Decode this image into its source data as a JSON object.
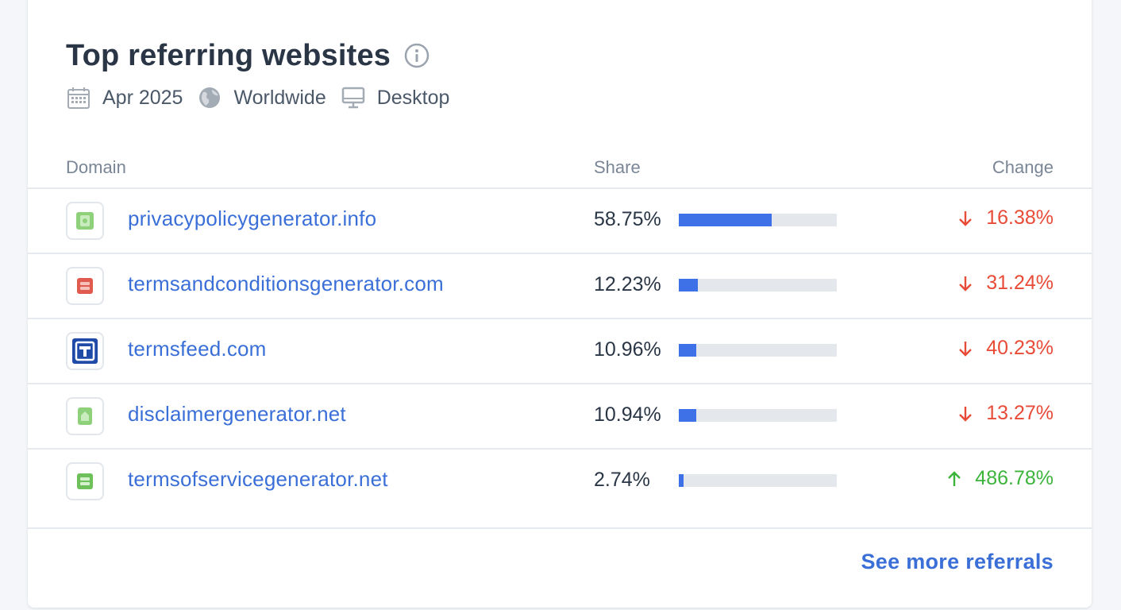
{
  "card": {
    "title": "Top referring websites",
    "meta": {
      "date": "Apr 2025",
      "region": "Worldwide",
      "device": "Desktop"
    }
  },
  "table": {
    "headers": {
      "domain": "Domain",
      "share": "Share",
      "change": "Change"
    },
    "rows": [
      {
        "domain": "privacypolicygenerator.info",
        "share": "58.75%",
        "share_value": 0.5875,
        "change": "16.38%",
        "direction": "down",
        "favicon": "green-document-icon"
      },
      {
        "domain": "termsandconditionsgenerator.com",
        "share": "12.23%",
        "share_value": 0.1223,
        "change": "31.24%",
        "direction": "down",
        "favicon": "red-document-icon"
      },
      {
        "domain": "termsfeed.com",
        "share": "10.96%",
        "share_value": 0.1096,
        "change": "40.23%",
        "direction": "down",
        "favicon": "termsfeed-logo-icon"
      },
      {
        "domain": "disclaimergenerator.net",
        "share": "10.94%",
        "share_value": 0.1094,
        "change": "13.27%",
        "direction": "down",
        "favicon": "green-document-icon"
      },
      {
        "domain": "termsofservicegenerator.net",
        "share": "2.74%",
        "share_value": 0.0274,
        "change": "486.78%",
        "direction": "up",
        "favicon": "green-document-icon"
      }
    ]
  },
  "footer": {
    "see_more_label": "See more referrals"
  },
  "colors": {
    "link": "#3b6fd8",
    "bar_fill": "#3e70e8",
    "bar_track": "#e4e7ec",
    "down": "#e84b37",
    "up": "#3cb43c",
    "title": "#2a3646"
  }
}
